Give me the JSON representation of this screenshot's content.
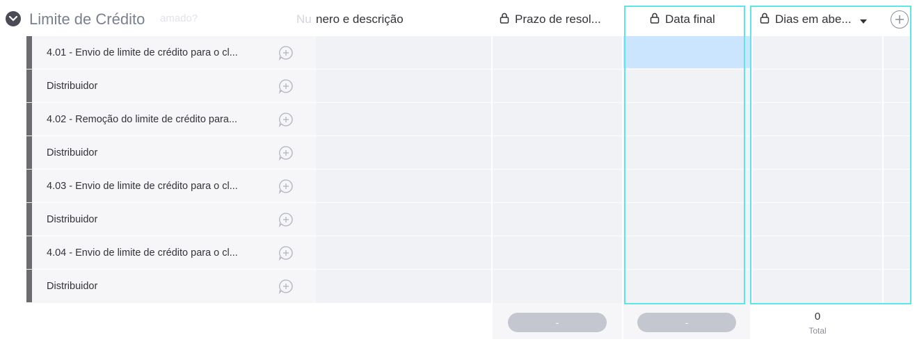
{
  "group": {
    "title": "Limite de Crédito",
    "ghost_hint": "amado?"
  },
  "columns": {
    "item_partial": "Nu",
    "numero": "nero e descrição",
    "prazo": "Prazo de resol...",
    "data_final": "Data final",
    "dias": "Dias em abe..."
  },
  "rows": [
    {
      "label": "4.01 - Envio de limite de crédito para o cl..."
    },
    {
      "label": "Distribuidor"
    },
    {
      "label": "4.02 - Remoção do limite de crédito para..."
    },
    {
      "label": "Distribuidor"
    },
    {
      "label": "4.03 - Envio de limite de crédito para o cl..."
    },
    {
      "label": "Distribuidor"
    },
    {
      "label": "4.04 - Envio de limite de crédito para o cl..."
    },
    {
      "label": "Distribuidor"
    }
  ],
  "footer": {
    "prazo_summary": "-",
    "data_final_summary": "-",
    "dias_total_value": "0",
    "dias_total_label": "Total"
  },
  "colors": {
    "highlight": "#5ce6e6",
    "selected_cell": "#cce5ff",
    "row_bar": "#6b6b70"
  },
  "icons": {
    "group_toggle": "chevron-down-icon",
    "lock": "lock-icon",
    "add_update": "add-update-icon",
    "add_column": "plus-circle-icon",
    "dropdown": "caret-down-icon"
  }
}
